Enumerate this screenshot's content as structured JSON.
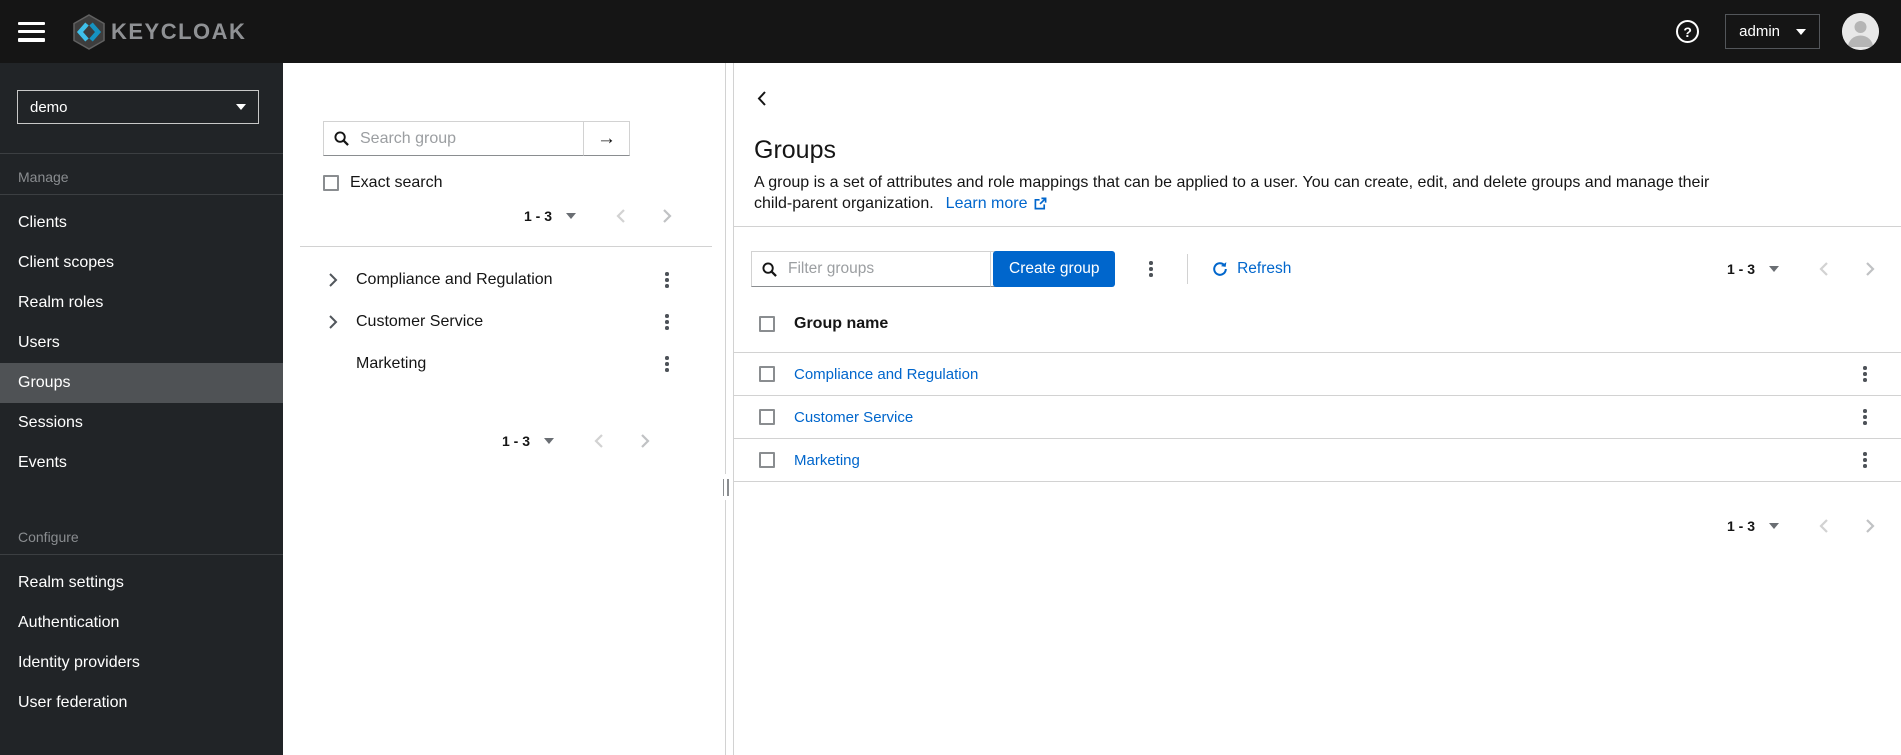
{
  "topbar": {
    "brand": "KEYCLOAK",
    "user_menu_label": "admin"
  },
  "sidebar": {
    "realm_selector": "demo",
    "selected_item": "Groups",
    "sections": [
      {
        "label": "Manage",
        "items": [
          "Clients",
          "Client scopes",
          "Realm roles",
          "Users",
          "Groups",
          "Sessions",
          "Events"
        ]
      },
      {
        "label": "Configure",
        "items": [
          "Realm settings",
          "Authentication",
          "Identity providers",
          "User federation"
        ]
      }
    ]
  },
  "tree_panel": {
    "search_placeholder": "Search group",
    "search_value": "",
    "exact_search_label": "Exact search",
    "pagination_range": "1 - 3",
    "groups": [
      {
        "name": "Compliance and Regulation",
        "expandable": true
      },
      {
        "name": "Customer Service",
        "expandable": true
      },
      {
        "name": "Marketing",
        "expandable": false
      }
    ]
  },
  "main": {
    "title": "Groups",
    "description_line1": "A group is a set of attributes and role mappings that can be applied to a user. You can create, edit, and delete groups and manage their",
    "description_line2": "child-parent organization.",
    "learn_more_label": "Learn more",
    "toolbar": {
      "filter_placeholder": "Filter groups",
      "filter_value": "",
      "create_group_label": "Create group",
      "refresh_label": "Refresh"
    },
    "pagination_range": "1 - 3",
    "table": {
      "column_header": "Group name",
      "rows": [
        {
          "name": "Compliance and Regulation"
        },
        {
          "name": "Customer Service"
        },
        {
          "name": "Marketing"
        }
      ]
    }
  },
  "icons": {
    "hamburger-icon": "≡",
    "keycloak-logo": "hexagon with double chevron",
    "help-icon": "?",
    "caret-down-icon": "▾",
    "avatar-icon": "person silhouette",
    "search-icon": "magnifier",
    "submit-arrow-icon": "→",
    "angle-right-icon": "›",
    "angle-left-icon": "‹",
    "kebab-icon": "⋮",
    "external-link-icon": "box with arrow",
    "refresh-icon": "circular arrows",
    "drag-handle-icon": "∥"
  },
  "colors": {
    "primary_blue": "#0066cc",
    "link_blue": "#0066cc",
    "masthead_bg": "#151515",
    "nav_bg": "#212427",
    "nav_selected_bg": "#4f5255",
    "border_gray": "#d2d2d2",
    "text_muted": "#8a8d90"
  }
}
